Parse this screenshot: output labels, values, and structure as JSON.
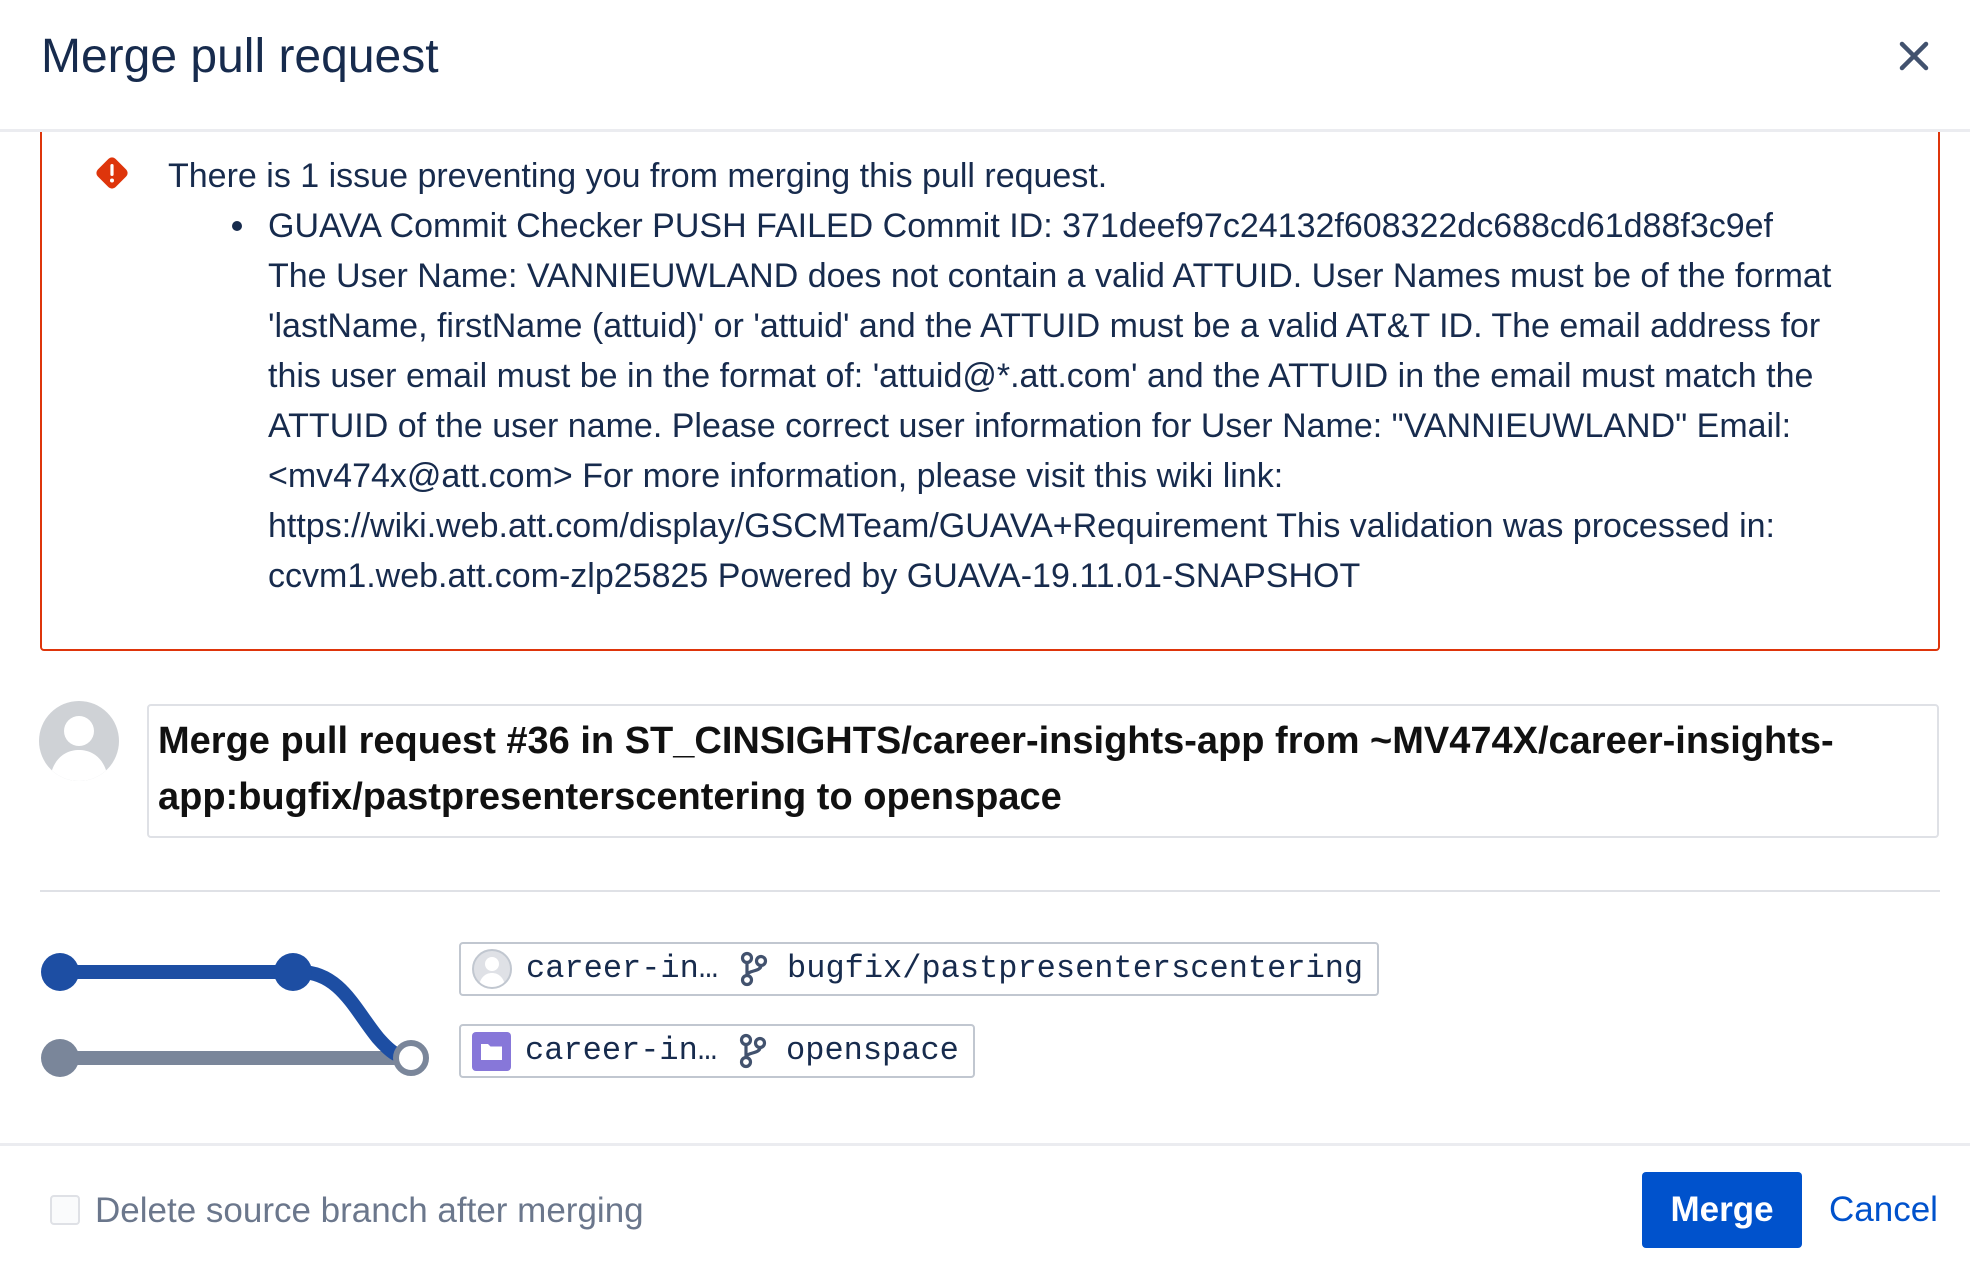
{
  "dialog": {
    "title": "Merge pull request",
    "close_icon": "close-icon"
  },
  "error": {
    "icon": "error-icon",
    "summary": "There is 1 issue preventing you from merging this pull request.",
    "issue_lines": [
      "GUAVA Commit Checker PUSH FAILED Commit ID: 371deef97c24132f608322dc688cd61d88f3c9ef",
      "The User Name: VANNIEUWLAND does not contain a valid ATTUID. User Names must be of the format",
      "'lastName, firstName (attuid)' or 'attuid' and the ATTUID must be a valid AT&T ID. The email address for",
      "this user email must be in the format of: 'attuid@*.att.com' and the ATTUID in the email must match the",
      "ATTUID of the user name. Please correct user information for User Name: \"VANNIEUWLAND\" Email:",
      "<mv474x@att.com> For more information, please visit this wiki link:",
      "https://wiki.web.att.com/display/GSCMTeam/GUAVA+Requirement This validation was processed in:",
      "ccvm1.web.att.com-zlp25825 Powered by GUAVA-19.11.01-SNAPSHOT"
    ]
  },
  "commit": {
    "avatar_icon": "default-avatar-icon",
    "message": "Merge pull request #36 in ST_CINSIGHTS/career-insights-app from ~MV474X/career-insights-app:bugfix/pastpresenterscentering to openspace"
  },
  "branches": {
    "source": {
      "repo_icon": "user-avatar-icon",
      "repo": "career-in…",
      "branch_icon": "branch-icon",
      "branch": "bugfix/pastpresenterscentering"
    },
    "target": {
      "repo_icon": "repository-icon",
      "repo": "career-in…",
      "branch_icon": "branch-icon",
      "branch": "openspace"
    }
  },
  "footer": {
    "delete_branch_label": "Delete source branch after merging",
    "delete_branch_checked": false,
    "merge_label": "Merge",
    "cancel_label": "Cancel"
  },
  "colors": {
    "accent": "#0052cc",
    "error": "#de350b",
    "text": "#172b4d",
    "subtle_text": "#6b778c",
    "graph_source": "#1d4ea3",
    "graph_target": "#7a869a",
    "repo_icon": "#8777d9"
  }
}
